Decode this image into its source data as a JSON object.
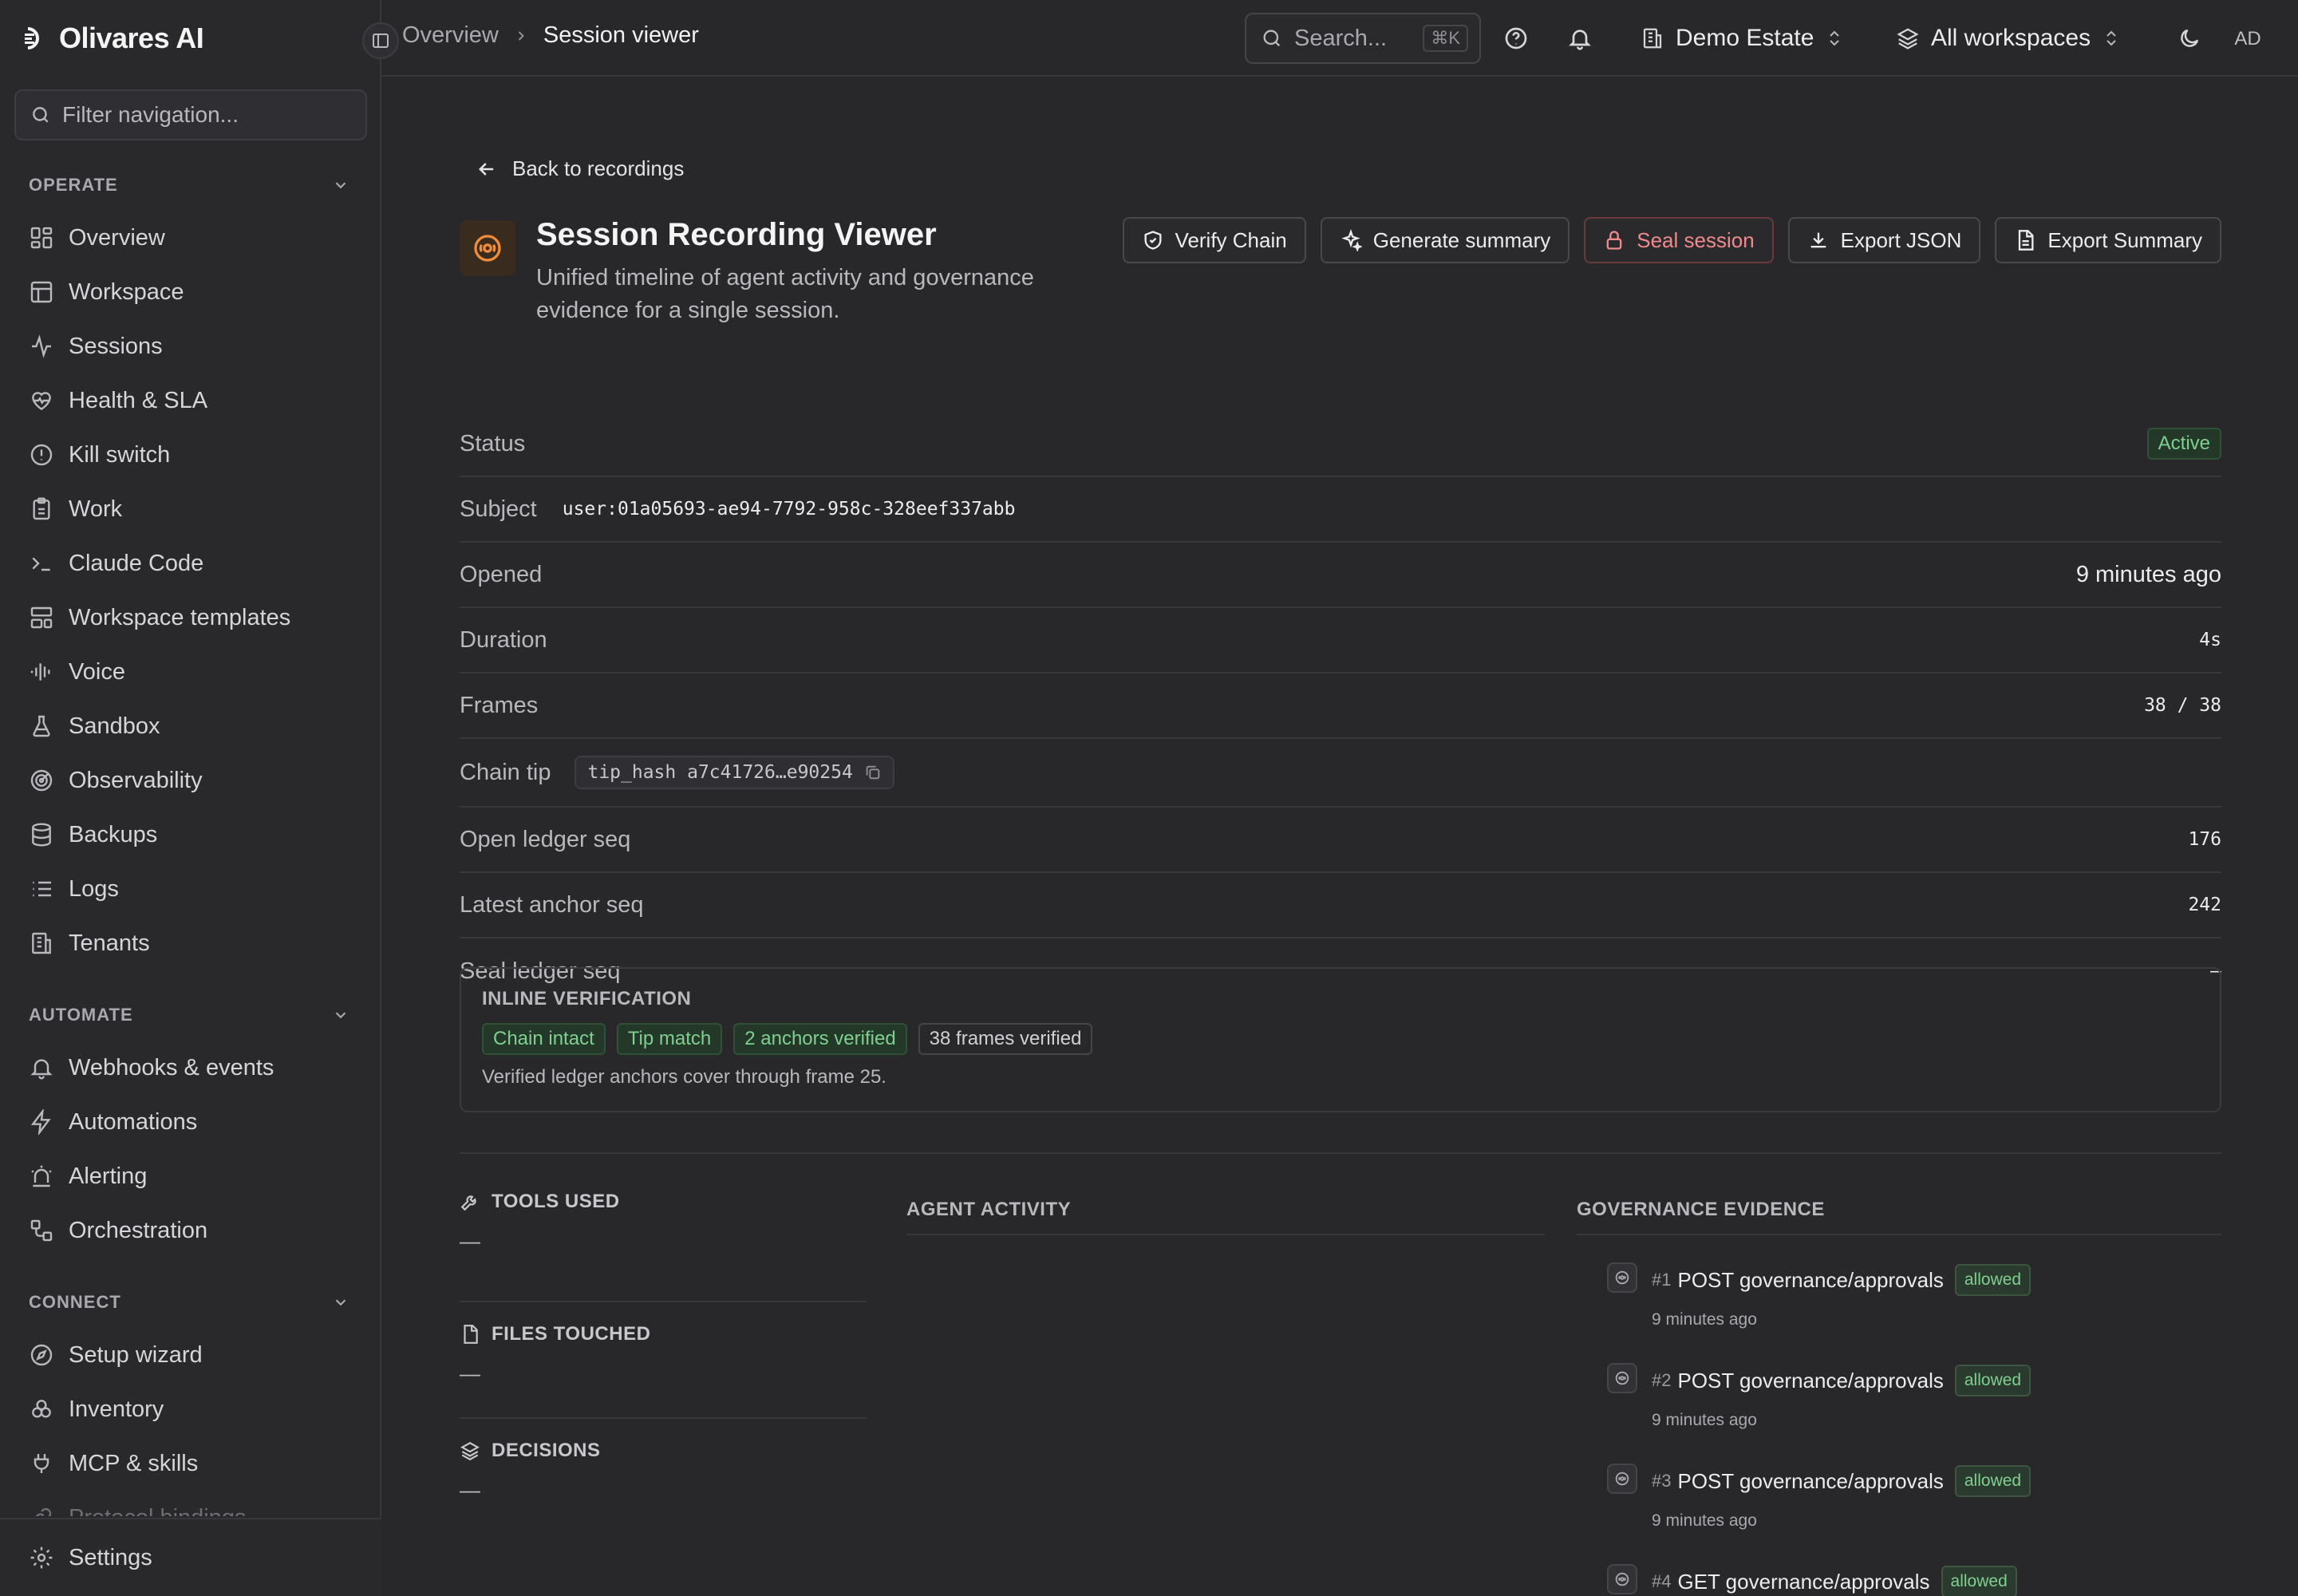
{
  "app": {
    "name": "Olivares AI"
  },
  "sidebar": {
    "filter_placeholder": "Filter navigation...",
    "sections": [
      {
        "title": "OPERATE",
        "items": [
          {
            "label": "Overview",
            "icon": "grid-icon"
          },
          {
            "label": "Workspace",
            "icon": "layout-icon"
          },
          {
            "label": "Sessions",
            "icon": "activity-icon"
          },
          {
            "label": "Health & SLA",
            "icon": "heart-pulse-icon"
          },
          {
            "label": "Kill switch",
            "icon": "alert-circle-icon"
          },
          {
            "label": "Work",
            "icon": "clipboard-icon"
          },
          {
            "label": "Claude Code",
            "icon": "terminal-icon"
          },
          {
            "label": "Workspace templates",
            "icon": "template-icon"
          },
          {
            "label": "Voice",
            "icon": "audio-lines-icon"
          },
          {
            "label": "Sandbox",
            "icon": "flask-icon"
          },
          {
            "label": "Observability",
            "icon": "radar-icon"
          },
          {
            "label": "Backups",
            "icon": "database-icon"
          },
          {
            "label": "Logs",
            "icon": "list-icon"
          },
          {
            "label": "Tenants",
            "icon": "building-icon"
          }
        ]
      },
      {
        "title": "AUTOMATE",
        "items": [
          {
            "label": "Webhooks & events",
            "icon": "bell-icon"
          },
          {
            "label": "Automations",
            "icon": "zap-icon"
          },
          {
            "label": "Alerting",
            "icon": "siren-icon"
          },
          {
            "label": "Orchestration",
            "icon": "workflow-icon"
          }
        ]
      },
      {
        "title": "CONNECT",
        "items": [
          {
            "label": "Setup wizard",
            "icon": "compass-icon"
          },
          {
            "label": "Inventory",
            "icon": "boxes-icon"
          },
          {
            "label": "MCP & skills",
            "icon": "plug-icon"
          },
          {
            "label": "Protocol bindings",
            "icon": "link-icon"
          }
        ]
      }
    ],
    "settings_label": "Settings"
  },
  "topbar": {
    "breadcrumb_parent": "Overview",
    "breadcrumb_current": "Session viewer",
    "search_placeholder": "Search...",
    "search_shortcut": "⌘K",
    "org": "Demo Estate",
    "workspace": "All workspaces",
    "avatar_initials": "AD"
  },
  "page": {
    "back_label": "Back to recordings",
    "title": "Session Recording Viewer",
    "subtitle": "Unified timeline of agent activity and governance evidence for a single session.",
    "actions": {
      "verify": "Verify Chain",
      "summary": "Generate summary",
      "seal": "Seal session",
      "export_json": "Export JSON",
      "export_summary": "Export Summary"
    },
    "props": {
      "status_label": "Status",
      "status_value": "Active",
      "subject_label": "Subject",
      "subject_value": "user:01a05693-ae94-7792-958c-328eef337abb",
      "opened_label": "Opened",
      "opened_value": "9 minutes ago",
      "duration_label": "Duration",
      "duration_value": "4s",
      "frames_label": "Frames",
      "frames_value": "38 / 38",
      "chain_label": "Chain tip",
      "chain_value": "tip_hash a7c41726…e90254",
      "open_seq_label": "Open ledger seq",
      "open_seq_value": "176",
      "anchor_seq_label": "Latest anchor seq",
      "anchor_seq_value": "242",
      "seal_seq_label": "Seal ledger seq",
      "seal_seq_value": "–"
    },
    "verification": {
      "heading": "INLINE VERIFICATION",
      "tags": [
        "Chain intact",
        "Tip match",
        "2 anchors verified",
        "38 frames verified"
      ],
      "note": "Verified ledger anchors cover through frame 25."
    },
    "tools": {
      "heading": "TOOLS USED",
      "value": "—"
    },
    "files": {
      "heading": "FILES TOUCHED",
      "value": "—"
    },
    "decisions": {
      "heading": "DECISIONS",
      "value": "—"
    },
    "agent_activity_heading": "AGENT ACTIVITY",
    "governance_heading": "GOVERNANCE EVIDENCE",
    "evidence": [
      {
        "num": "#1",
        "label": "POST governance/approvals",
        "status": "allowed",
        "time": "9 minutes ago"
      },
      {
        "num": "#2",
        "label": "POST governance/approvals",
        "status": "allowed",
        "time": "9 minutes ago"
      },
      {
        "num": "#3",
        "label": "POST governance/approvals",
        "status": "allowed",
        "time": "9 minutes ago"
      },
      {
        "num": "#4",
        "label": "GET governance/approvals",
        "status": "allowed",
        "time": ""
      }
    ]
  }
}
